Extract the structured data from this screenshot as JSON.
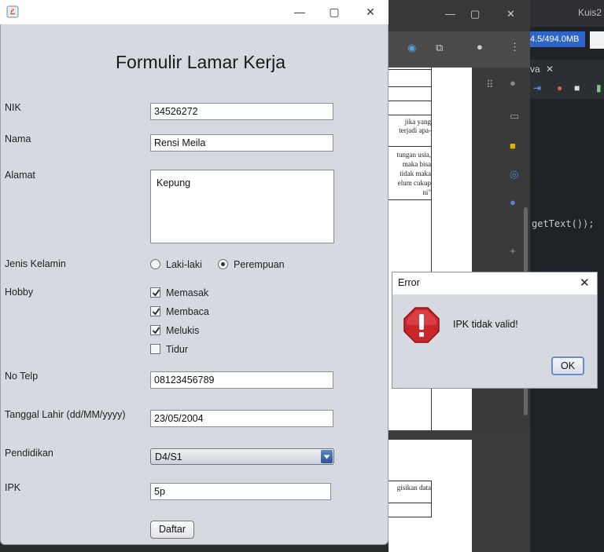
{
  "background": {
    "ide_title": "Kuis2",
    "ide_memory": "4.5/494.0MB",
    "ide_tab": "va",
    "ide_code": "getText());",
    "doc_snippets": [
      "jika yang",
      "terjadi apa-",
      "tungan usia,",
      "maka bisa",
      "tidak maka",
      "elum cukup",
      "ni\"",
      "gisikan data"
    ]
  },
  "form": {
    "title": "Formulir Lamar Kerja",
    "labels": {
      "nik": "NIK",
      "nama": "Nama",
      "alamat": "Alamat",
      "jenis_kelamin": "Jenis Kelamin",
      "hobby": "Hobby",
      "no_telp": "No Telp",
      "tanggal_lahir": "Tanggal Lahir (dd/MM/yyyy)",
      "pendidikan": "Pendidikan",
      "ipk": "IPK"
    },
    "values": {
      "nik": "34526272",
      "nama": "Rensi Meila",
      "alamat": "Kepung",
      "no_telp": "08123456789",
      "tanggal_lahir": "23/05/2004",
      "pendidikan": "D4/S1",
      "ipk": "5p"
    },
    "gender_options": [
      {
        "label": "Laki-laki",
        "selected": false
      },
      {
        "label": "Perempuan",
        "selected": true
      }
    ],
    "hobbies": [
      {
        "label": "Memasak",
        "checked": true
      },
      {
        "label": "Membaca",
        "checked": true
      },
      {
        "label": "Melukis",
        "checked": true
      },
      {
        "label": "Tidur",
        "checked": false
      }
    ],
    "submit_label": "Daftar"
  },
  "dialog": {
    "title": "Error",
    "message": "IPK tidak valid!",
    "ok_label": "OK",
    "icon": "error-icon"
  }
}
